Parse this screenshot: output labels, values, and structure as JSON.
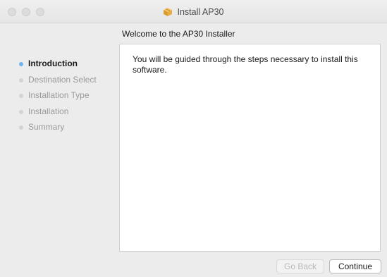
{
  "window": {
    "title": "Install AP30",
    "title_icon": "package-icon"
  },
  "heading": "Welcome to the  AP30  Installer",
  "sidebar": {
    "steps": [
      {
        "label": "Introduction",
        "active": true
      },
      {
        "label": "Destination Select",
        "active": false
      },
      {
        "label": "Installation Type",
        "active": false
      },
      {
        "label": "Installation",
        "active": false
      },
      {
        "label": "Summary",
        "active": false
      }
    ]
  },
  "content": {
    "text": "You will be guided through the steps necessary to install this software."
  },
  "buttons": {
    "go_back": "Go Back",
    "continue": "Continue"
  },
  "colors": {
    "active_dot": "#6fb2ee",
    "inactive_dot": "#d3d3d3",
    "window_bg": "#ececec"
  }
}
